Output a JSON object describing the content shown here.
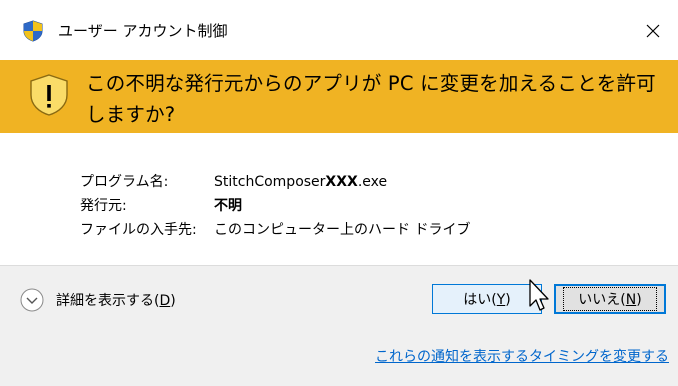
{
  "window": {
    "title": "ユーザー アカウント制御",
    "shield_icon": "uac-shield-icon",
    "close_icon": "close-icon"
  },
  "banner": {
    "icon": "warning-icon",
    "message": "この不明な発行元からのアプリが PC に変更を加えることを許可しますか?",
    "color": "#f0b323"
  },
  "details": {
    "program_label": "プログラム名:",
    "program_value_prefix": "StitchComposer",
    "program_value_bold": "XXX",
    "program_value_suffix": ".exe",
    "publisher_label": "発行元:",
    "publisher_value": "不明",
    "origin_label": "ファイルの入手先:",
    "origin_value": "このコンピューター上のハード ドライブ"
  },
  "footer": {
    "show_details_label": "詳細を表示する(",
    "show_details_key": "D",
    "show_details_suffix": ")",
    "yes_label": "はい(",
    "yes_key": "Y",
    "yes_suffix": ")",
    "no_label": "いいえ(",
    "no_key": "N",
    "no_suffix": ")",
    "link_text": "これらの通知を表示するタイミングを変更する",
    "accent_color": "#0078d7",
    "link_color": "#0066cc"
  }
}
